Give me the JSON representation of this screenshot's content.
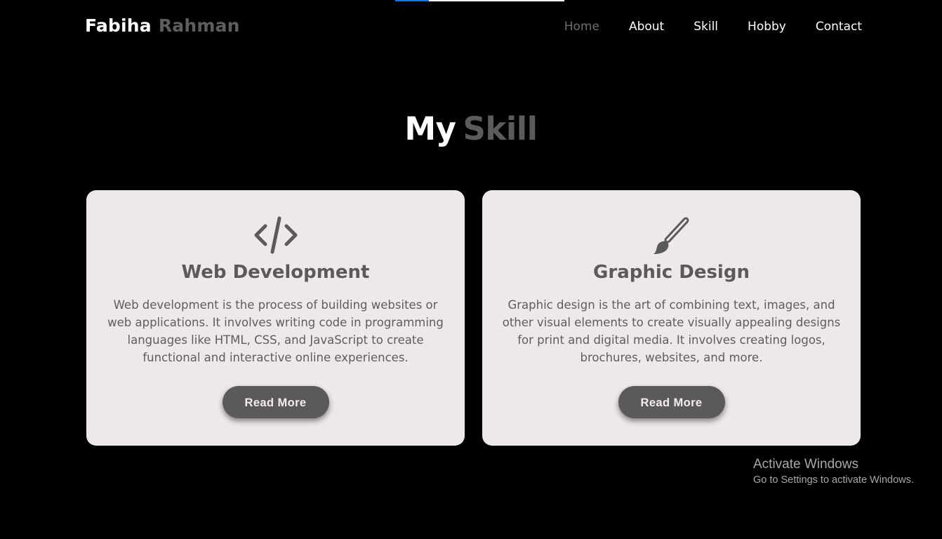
{
  "top_bar": {
    "progress_fraction": 0.2
  },
  "header": {
    "brand_first": "Fabiha",
    "brand_last": "Rahman",
    "nav": [
      {
        "label": "Home",
        "active": true
      },
      {
        "label": "About",
        "active": false
      },
      {
        "label": "Skill",
        "active": false
      },
      {
        "label": "Hobby",
        "active": false
      },
      {
        "label": "Contact",
        "active": false
      }
    ]
  },
  "section": {
    "title_part1": "My",
    "title_part2": "Skill"
  },
  "cards": [
    {
      "icon": "code-icon",
      "title": "Web Development",
      "description": "Web development is the process of building websites or web applications. It involves writing code in programming languages like HTML, CSS, and JavaScript to create functional and interactive online experiences.",
      "button": "Read More"
    },
    {
      "icon": "paintbrush-icon",
      "title": "Graphic Design",
      "description": "Graphic design is the art of combining text, images, and other visual elements to create visually appealing designs for print and digital media. It involves creating logos, brochures, websites, and more.",
      "button": "Read More"
    }
  ],
  "watermark": {
    "title": "Activate Windows",
    "subtitle": "Go to Settings to activate Windows."
  },
  "colors": {
    "background": "#000000",
    "card": "#efe8e8",
    "accent_gray": "#5b5959",
    "progress_blue": "#1a73e8"
  }
}
